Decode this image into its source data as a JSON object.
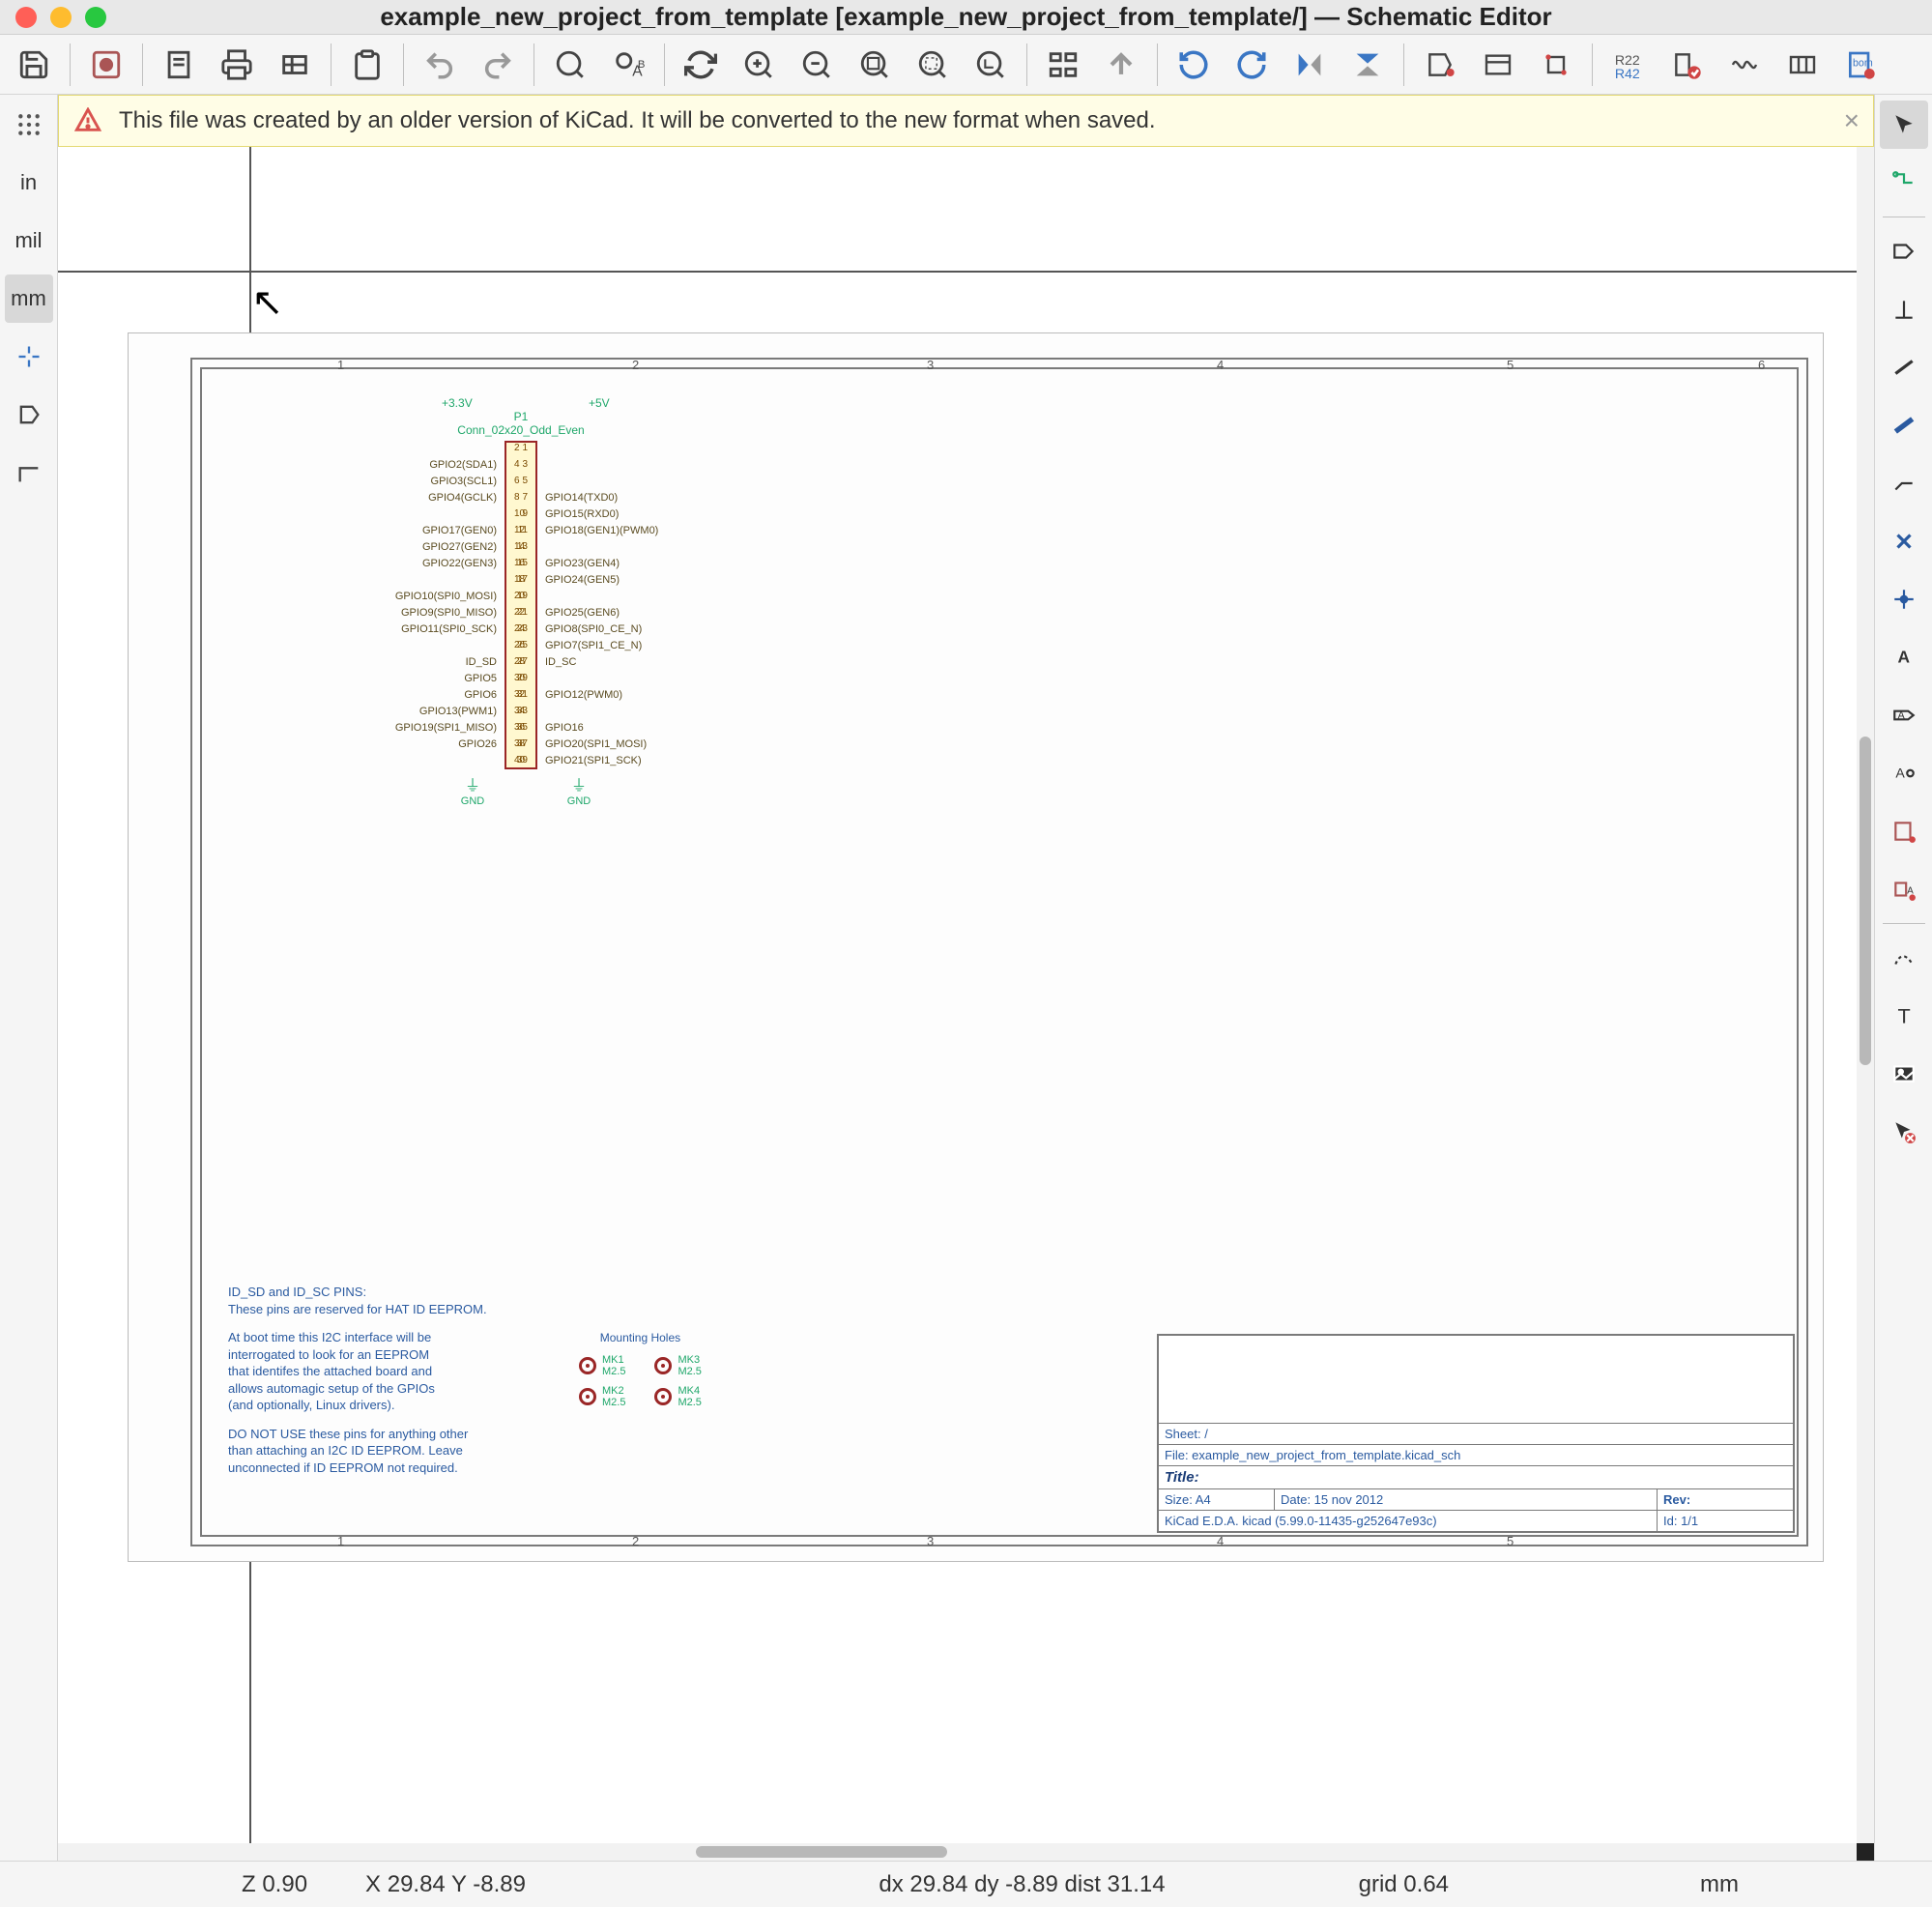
{
  "window": {
    "title": "example_new_project_from_template [example_new_project_from_template/] — Schematic Editor",
    "infobar": "This file was created by an older version of KiCad. It will be converted to the new format when saved."
  },
  "left_units": {
    "in": "in",
    "mil": "mil",
    "mm": "mm"
  },
  "status": {
    "z": "Z 0.90",
    "xy": "X 29.84  Y -8.89",
    "dxy": "dx 29.84  dy -8.89  dist 31.14",
    "grid": "grid 0.64",
    "unit": "mm"
  },
  "connector": {
    "v1": "+3.3V",
    "v2": "+5V",
    "ref": "P1",
    "name": "Conn_02x20_Odd_Even",
    "gnd": "GND",
    "rows": [
      {
        "l": "",
        "nl": "1",
        "nr": "2",
        "r": ""
      },
      {
        "l": "GPIO2(SDA1)",
        "nl": "3",
        "nr": "4",
        "r": ""
      },
      {
        "l": "GPIO3(SCL1)",
        "nl": "5",
        "nr": "6",
        "r": ""
      },
      {
        "l": "GPIO4(GCLK)",
        "nl": "7",
        "nr": "8",
        "r": "GPIO14(TXD0)"
      },
      {
        "l": "",
        "nl": "9",
        "nr": "10",
        "r": "GPIO15(RXD0)"
      },
      {
        "l": "GPIO17(GEN0)",
        "nl": "11",
        "nr": "12",
        "r": "GPIO18(GEN1)(PWM0)"
      },
      {
        "l": "GPIO27(GEN2)",
        "nl": "13",
        "nr": "14",
        "r": ""
      },
      {
        "l": "GPIO22(GEN3)",
        "nl": "15",
        "nr": "16",
        "r": "GPIO23(GEN4)"
      },
      {
        "l": "",
        "nl": "17",
        "nr": "18",
        "r": "GPIO24(GEN5)"
      },
      {
        "l": "GPIO10(SPI0_MOSI)",
        "nl": "19",
        "nr": "20",
        "r": ""
      },
      {
        "l": "GPIO9(SPI0_MISO)",
        "nl": "21",
        "nr": "22",
        "r": "GPIO25(GEN6)"
      },
      {
        "l": "GPIO11(SPI0_SCK)",
        "nl": "23",
        "nr": "24",
        "r": "GPIO8(SPI0_CE_N)"
      },
      {
        "l": "",
        "nl": "25",
        "nr": "26",
        "r": "GPIO7(SPI1_CE_N)"
      },
      {
        "l": "ID_SD",
        "nl": "27",
        "nr": "28",
        "r": "ID_SC"
      },
      {
        "l": "GPIO5",
        "nl": "29",
        "nr": "30",
        "r": ""
      },
      {
        "l": "GPIO6",
        "nl": "31",
        "nr": "32",
        "r": "GPIO12(PWM0)"
      },
      {
        "l": "GPIO13(PWM1)",
        "nl": "33",
        "nr": "34",
        "r": ""
      },
      {
        "l": "GPIO19(SPI1_MISO)",
        "nl": "35",
        "nr": "36",
        "r": "GPIO16"
      },
      {
        "l": "GPIO26",
        "nl": "37",
        "nr": "38",
        "r": "GPIO20(SPI1_MOSI)"
      },
      {
        "l": "",
        "nl": "39",
        "nr": "40",
        "r": "GPIO21(SPI1_SCK)"
      }
    ]
  },
  "notes": {
    "p1": "ID_SD and ID_SC PINS:\nThese pins are reserved for HAT ID EEPROM.",
    "p2": "At boot time this I2C interface will be\ninterrogated to look for an EEPROM\nthat identifes the attached board and\nallows automagic setup of the GPIOs\n(and optionally, Linux drivers).",
    "p3": "DO NOT USE these pins for anything other\nthan attaching an I2C ID EEPROM. Leave\nunconnected if ID EEPROM not required."
  },
  "mounting": {
    "title": "Mounting Holes",
    "items": [
      {
        "ref": "MK1",
        "val": "M2.5"
      },
      {
        "ref": "MK3",
        "val": "M2.5"
      },
      {
        "ref": "MK2",
        "val": "M2.5"
      },
      {
        "ref": "MK4",
        "val": "M2.5"
      }
    ]
  },
  "titleblock": {
    "sheet": "Sheet: /",
    "file": "File: example_new_project_from_template.kicad_sch",
    "title_lbl": "Title:",
    "size": "Size: A4",
    "date": "Date: 15 nov 2012",
    "rev": "Rev:",
    "kicad": "KiCad E.D.A.  kicad (5.99.0-11435-g252647e93c)",
    "id": "Id: 1/1"
  },
  "ruler": {
    "r1": "1",
    "r2": "2",
    "r3": "3",
    "r4": "4",
    "r5": "5",
    "r6": "6"
  }
}
